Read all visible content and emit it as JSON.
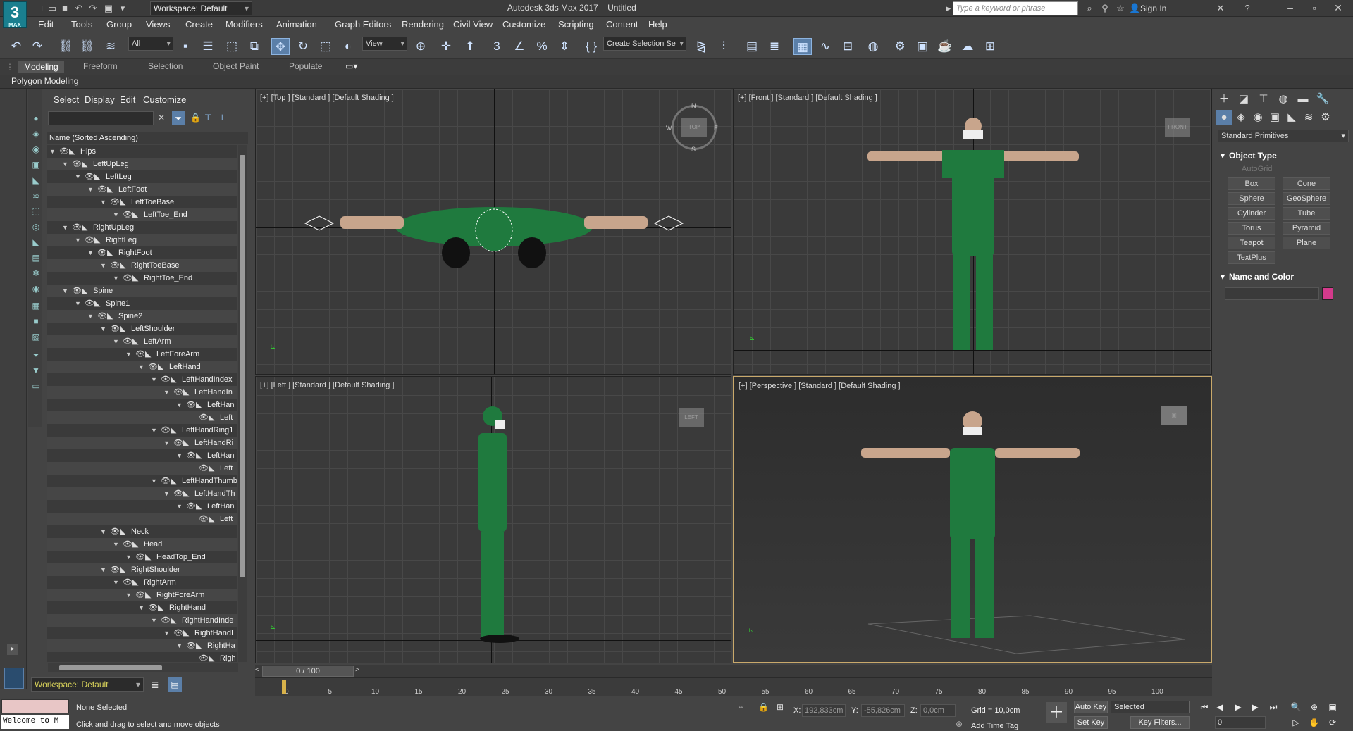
{
  "app": {
    "logo_text": "3",
    "logo_sub": "MAX",
    "title": "Autodesk 3ds Max 2017",
    "doc": "Untitled",
    "workspace": "Workspace: Default",
    "search_placeholder": "Type a keyword or phrase",
    "sign_in": "Sign In"
  },
  "menus": [
    "Edit",
    "Tools",
    "Group",
    "Views",
    "Create",
    "Modifiers",
    "Animation",
    "Graph Editors",
    "Rendering",
    "Civil View",
    "Customize",
    "Scripting",
    "Content",
    "Help"
  ],
  "toolbar": {
    "filter": "All",
    "refcoord": "View",
    "selection_set": "Create Selection Se"
  },
  "ribbon": {
    "tabs": [
      "Modeling",
      "Freeform",
      "Selection",
      "Object Paint",
      "Populate"
    ],
    "panel": "Polygon Modeling"
  },
  "explorer": {
    "menus": [
      "Select",
      "Display",
      "Edit",
      "Customize"
    ],
    "column_header": "Name (Sorted Ascending)",
    "rows": [
      {
        "label": "Hips",
        "depth": 0
      },
      {
        "label": "LeftUpLeg",
        "depth": 1
      },
      {
        "label": "LeftLeg",
        "depth": 2
      },
      {
        "label": "LeftFoot",
        "depth": 3
      },
      {
        "label": "LeftToeBase",
        "depth": 4
      },
      {
        "label": "LeftToe_End",
        "depth": 5
      },
      {
        "label": "RightUpLeg",
        "depth": 1
      },
      {
        "label": "RightLeg",
        "depth": 2
      },
      {
        "label": "RightFoot",
        "depth": 3
      },
      {
        "label": "RightToeBase",
        "depth": 4
      },
      {
        "label": "RightToe_End",
        "depth": 5
      },
      {
        "label": "Spine",
        "depth": 1
      },
      {
        "label": "Spine1",
        "depth": 2
      },
      {
        "label": "Spine2",
        "depth": 3
      },
      {
        "label": "LeftShoulder",
        "depth": 4
      },
      {
        "label": "LeftArm",
        "depth": 5
      },
      {
        "label": "LeftForeArm",
        "depth": 6
      },
      {
        "label": "LeftHand",
        "depth": 7
      },
      {
        "label": "LeftHandIndex",
        "depth": 8
      },
      {
        "label": "LeftHandIn",
        "depth": 9
      },
      {
        "label": "LeftHan",
        "depth": 10
      },
      {
        "label": "Left",
        "depth": 11
      },
      {
        "label": "LeftHandRing1",
        "depth": 8
      },
      {
        "label": "LeftHandRi",
        "depth": 9
      },
      {
        "label": "LeftHan",
        "depth": 10
      },
      {
        "label": "Left",
        "depth": 11
      },
      {
        "label": "LeftHandThumb",
        "depth": 8
      },
      {
        "label": "LeftHandTh",
        "depth": 9
      },
      {
        "label": "LeftHan",
        "depth": 10
      },
      {
        "label": "Left",
        "depth": 11
      },
      {
        "label": "Neck",
        "depth": 4
      },
      {
        "label": "Head",
        "depth": 5
      },
      {
        "label": "HeadTop_End",
        "depth": 6
      },
      {
        "label": "RightShoulder",
        "depth": 4
      },
      {
        "label": "RightArm",
        "depth": 5
      },
      {
        "label": "RightForeArm",
        "depth": 6
      },
      {
        "label": "RightHand",
        "depth": 7
      },
      {
        "label": "RightHandInde",
        "depth": 8
      },
      {
        "label": "RightHandI",
        "depth": 9
      },
      {
        "label": "RightHa",
        "depth": 10
      },
      {
        "label": "Righ",
        "depth": 11
      }
    ],
    "workspace": "Workspace: Default"
  },
  "viewports": {
    "top": "[+] [Top ] [Standard ] [Default Shading ]",
    "front": "[+] [Front ] [Standard ] [Default Shading ]",
    "left": "[+] [Left ] [Standard ] [Default Shading ]",
    "perspective": "[+] [Perspective ] [Standard ] [Default Shading ]",
    "cube_top": "TOP",
    "cube_front": "FRONT",
    "cube_left": "LEFT",
    "compass": {
      "n": "N",
      "s": "S",
      "e": "E",
      "w": "W"
    }
  },
  "command_panel": {
    "category": "Standard Primitives",
    "object_type_title": "Object Type",
    "autogrid": "AutoGrid",
    "buttons": [
      "Box",
      "Cone",
      "Sphere",
      "GeoSphere",
      "Cylinder",
      "Tube",
      "Torus",
      "Pyramid",
      "Teapot",
      "Plane",
      "TextPlus"
    ],
    "name_color_title": "Name and Color",
    "color": "#d33a8b"
  },
  "timeline": {
    "slider": "0 / 100",
    "ticks": [
      "0",
      "5",
      "10",
      "15",
      "20",
      "25",
      "30",
      "35",
      "40",
      "45",
      "50",
      "55",
      "60",
      "65",
      "70",
      "75",
      "80",
      "85",
      "90",
      "95",
      "100"
    ]
  },
  "status": {
    "maxscript": "Welcome to M",
    "selection": "None Selected",
    "prompt": "Click and drag to select and move objects",
    "x_label": "X:",
    "x": "192,833cm",
    "y_label": "Y:",
    "y": "-55,826cm",
    "z_label": "Z:",
    "z": "0,0cm",
    "grid": "Grid = 10,0cm",
    "add_time_tag": "Add Time Tag",
    "auto_key": "Auto Key",
    "set_key": "Set Key",
    "key_mode": "Selected",
    "key_filters": "Key Filters...",
    "frame": "0"
  }
}
